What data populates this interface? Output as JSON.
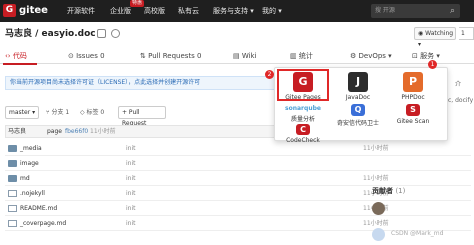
{
  "topnav": {
    "logo_text": "gitee",
    "items": [
      "开源软件",
      "企业版",
      "高校版",
      "私有云",
      "服务与支持 ▾",
      "我的 ▾"
    ],
    "enterprise_badge": "特惠",
    "search_placeholder": "搜 开源"
  },
  "repo": {
    "title": "马志良 / easyio.doc",
    "watch_label": "◉ Watching ▾",
    "watch_count": "1"
  },
  "tabs": [
    "‹› 代码",
    "⊙ Issues 0",
    "⇅ Pull Requests 0",
    "▤ Wiki",
    "▥ 统计",
    "⚙ DevOps ▾",
    "⊡ 服务 ▾"
  ],
  "notice": "你当前开源项目尚未选择许可证（LICENSE），点此选择并创建开源许可",
  "branch": {
    "name": "master ▾",
    "branches": "⑂ 分支 1",
    "tags": "◇ 标签 0",
    "pull_request": "+ Pull Request"
  },
  "commit": {
    "author": "马志良",
    "message": "page",
    "hash": "fbe66f0",
    "time": "11小时前"
  },
  "files": [
    {
      "name": "_media",
      "msg": "init",
      "time": "11小时前",
      "type": "folder"
    },
    {
      "name": "image",
      "msg": "init",
      "time": "",
      "type": "folder"
    },
    {
      "name": "md",
      "msg": "init",
      "time": "11小时前",
      "type": "folder"
    },
    {
      "name": ".nojekyll",
      "msg": "init",
      "time": "11小时前",
      "type": "doc"
    },
    {
      "name": "README.md",
      "msg": "init",
      "time": "11小时前",
      "type": "doc"
    },
    {
      "name": "_coverpage.md",
      "msg": "init",
      "time": "11小时前",
      "type": "doc"
    }
  ],
  "sidebar": {
    "line1": "介",
    "line2": "c, docify",
    "contributors_title": "贡献者",
    "contributors_count": "(1)"
  },
  "dropdown": {
    "items": [
      {
        "label": "Gitee Pages",
        "icon": "G",
        "color": "#c71d23"
      },
      {
        "label": "JavaDoc",
        "icon": "J",
        "color": "#2d2d2d"
      },
      {
        "label": "PHPDoc",
        "icon": "P",
        "color": "#e46b2b"
      },
      {
        "label": "质量分析",
        "icon": "sonarqube",
        "color": "#4b9fd5"
      },
      {
        "label": "奇安信代码卫士",
        "icon": "Q",
        "color": "#3a6fd8"
      },
      {
        "label": "Gitee Scan",
        "icon": "S",
        "color": "#c71d23"
      },
      {
        "label": "CodeCheck",
        "icon": "C",
        "color": "#c71d23"
      }
    ],
    "badge1": "1",
    "badge2": "2"
  },
  "watermark": "CSDN @Mark_md"
}
